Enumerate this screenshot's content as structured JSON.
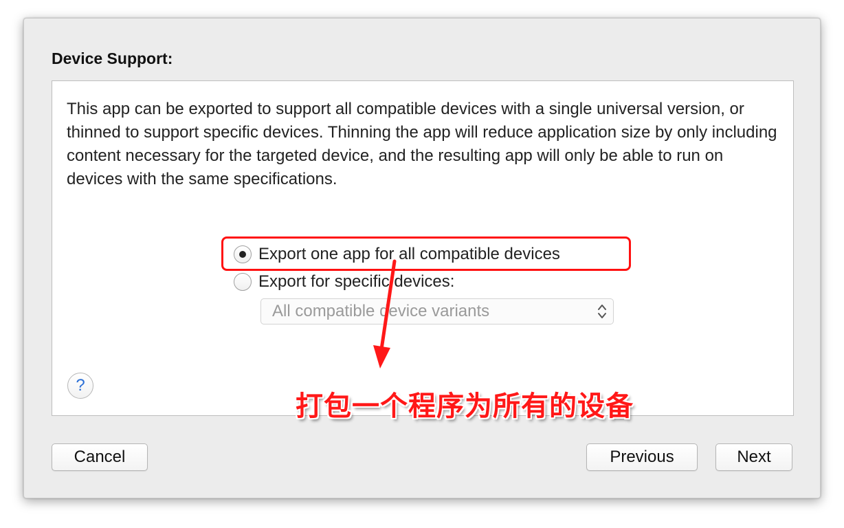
{
  "dialog": {
    "section_title": "Device Support:",
    "description": "This app can be exported to support all compatible devices with a single universal version, or thinned to support specific devices.  Thinning the app will reduce application size by only including content necessary for the targeted device, and the resulting app will only be able to run on devices with the same specifications.",
    "options": [
      {
        "label": "Export one app for all compatible devices",
        "selected": true
      },
      {
        "label": "Export for specific devices:",
        "selected": false
      }
    ],
    "device_select": {
      "value": "All compatible device variants",
      "enabled": false
    },
    "help_label": "?"
  },
  "annotation": {
    "text": "打包一个程序为所有的设备",
    "color": "#ff1818"
  },
  "buttons": {
    "cancel": "Cancel",
    "previous": "Previous",
    "next": "Next"
  },
  "icons": {
    "radio_selected": "radio-selected-icon",
    "radio_unselected": "radio-unselected-icon",
    "select_chevrons": "up-down-chevron-icon",
    "help": "question-mark-icon",
    "arrow": "red-arrow-icon"
  }
}
